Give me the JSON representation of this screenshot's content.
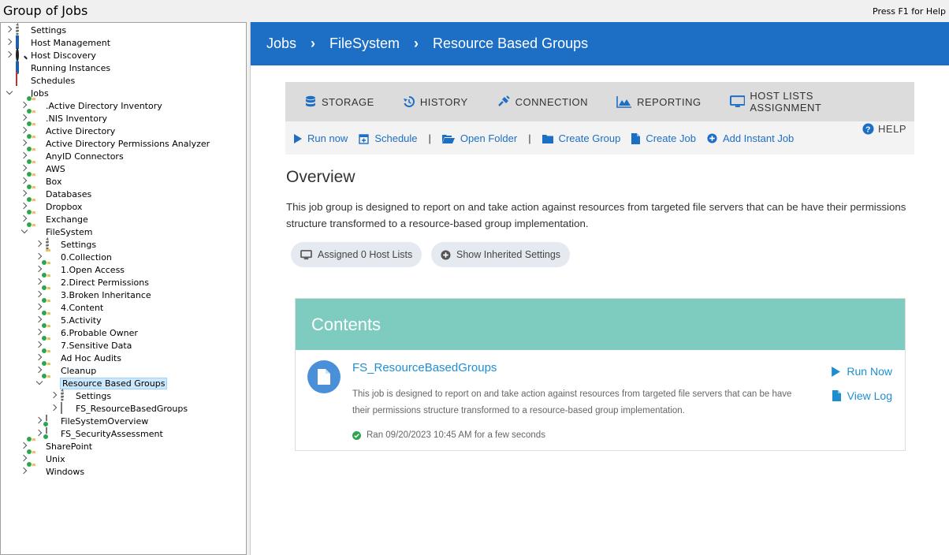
{
  "window": {
    "title": "Group of Jobs",
    "help_hint": "Press F1 for Help"
  },
  "tree": [
    {
      "label": "Settings",
      "level": 0,
      "toggle": "c",
      "icon": "gears-icon"
    },
    {
      "label": "Host Management",
      "level": 0,
      "toggle": "c",
      "icon": "monitor-icon"
    },
    {
      "label": "Host Discovery",
      "level": 0,
      "toggle": "c",
      "icon": "magnifier-icon"
    },
    {
      "label": "Running Instances",
      "level": 0,
      "toggle": "",
      "icon": "running-instances-icon"
    },
    {
      "label": "Schedules",
      "level": 0,
      "toggle": "",
      "icon": "calendar-icon"
    },
    {
      "label": "Jobs",
      "level": 0,
      "toggle": "e",
      "icon": "open-folder-icon"
    },
    {
      "label": ".Active Directory Inventory",
      "level": 1,
      "toggle": "c",
      "icon": "job-group-folder-icon"
    },
    {
      "label": ".NIS Inventory",
      "level": 1,
      "toggle": "c",
      "icon": "job-group-folder-icon"
    },
    {
      "label": "Active Directory",
      "level": 1,
      "toggle": "c",
      "icon": "job-group-folder-icon"
    },
    {
      "label": "Active Directory Permissions Analyzer",
      "level": 1,
      "toggle": "c",
      "icon": "job-group-folder-icon"
    },
    {
      "label": "AnyID Connectors",
      "level": 1,
      "toggle": "c",
      "icon": "job-group-folder-icon"
    },
    {
      "label": "AWS",
      "level": 1,
      "toggle": "c",
      "icon": "job-group-folder-icon"
    },
    {
      "label": "Box",
      "level": 1,
      "toggle": "c",
      "icon": "job-group-folder-icon"
    },
    {
      "label": "Databases",
      "level": 1,
      "toggle": "c",
      "icon": "job-group-folder-icon"
    },
    {
      "label": "Dropbox",
      "level": 1,
      "toggle": "c",
      "icon": "job-group-folder-icon"
    },
    {
      "label": "Exchange",
      "level": 1,
      "toggle": "c",
      "icon": "job-group-folder-icon"
    },
    {
      "label": "FileSystem",
      "level": 1,
      "toggle": "e",
      "icon": "job-group-folder-icon"
    },
    {
      "label": "Settings",
      "level": 2,
      "toggle": "c",
      "icon": "gears-icon"
    },
    {
      "label": "0.Collection",
      "level": 2,
      "toggle": "c",
      "icon": "folder-icon"
    },
    {
      "label": "1.Open Access",
      "level": 2,
      "toggle": "c",
      "icon": "job-group-folder-icon"
    },
    {
      "label": "2.Direct Permissions",
      "level": 2,
      "toggle": "c",
      "icon": "job-group-folder-icon"
    },
    {
      "label": "3.Broken Inheritance",
      "level": 2,
      "toggle": "c",
      "icon": "job-group-folder-icon"
    },
    {
      "label": "4.Content",
      "level": 2,
      "toggle": "c",
      "icon": "job-group-folder-icon"
    },
    {
      "label": "5.Activity",
      "level": 2,
      "toggle": "c",
      "icon": "job-group-folder-icon"
    },
    {
      "label": "6.Probable Owner",
      "level": 2,
      "toggle": "c",
      "icon": "job-group-folder-icon"
    },
    {
      "label": "7.Sensitive Data",
      "level": 2,
      "toggle": "c",
      "icon": "job-group-folder-icon"
    },
    {
      "label": "Ad Hoc Audits",
      "level": 2,
      "toggle": "c",
      "icon": "job-group-folder-icon"
    },
    {
      "label": "Cleanup",
      "level": 2,
      "toggle": "c",
      "icon": "job-group-folder-icon"
    },
    {
      "label": "Resource Based Groups",
      "level": 2,
      "toggle": "e",
      "icon": "job-group-folder-icon",
      "selected": true
    },
    {
      "label": "Settings",
      "level": 3,
      "toggle": "c",
      "icon": "gears-icon"
    },
    {
      "label": "FS_ResourceBasedGroups",
      "level": 3,
      "toggle": "c",
      "icon": "job-document-icon"
    },
    {
      "label": "FileSystemOverview",
      "level": 2,
      "toggle": "c",
      "icon": "job-document-checked-icon"
    },
    {
      "label": "FS_SecurityAssessment",
      "level": 2,
      "toggle": "c",
      "icon": "job-document-checked-icon"
    },
    {
      "label": "SharePoint",
      "level": 1,
      "toggle": "c",
      "icon": "job-group-folder-icon"
    },
    {
      "label": "Unix",
      "level": 1,
      "toggle": "c",
      "icon": "job-group-folder-icon"
    },
    {
      "label": "Windows",
      "level": 1,
      "toggle": "c",
      "icon": "job-group-folder-icon"
    }
  ],
  "breadcrumb": [
    "Jobs",
    "FileSystem",
    "Resource Based Groups"
  ],
  "tabs": [
    "STORAGE",
    "HISTORY",
    "CONNECTION",
    "REPORTING",
    "HOST LISTS ASSIGNMENT"
  ],
  "actions": {
    "run_now": "Run now",
    "schedule": "Schedule",
    "open_folder": "Open Folder",
    "create_group": "Create Group",
    "create_job": "Create Job",
    "add_instant_job": "Add Instant Job",
    "help": "HELP",
    "separator": "|"
  },
  "overview": {
    "title": "Overview",
    "description": "This job group is designed to report on and take action against resources from targeted file servers that can be have their permissions structure transformed to a resource-based group implementation.",
    "assigned_hosts": "Assigned 0 Host Lists",
    "show_inherited": "Show Inherited Settings"
  },
  "contents": {
    "title": "Contents",
    "job": {
      "name": "FS_ResourceBasedGroups",
      "description": "This job is designed to report on and take action against resources from targeted file servers that can be have their permissions structure transformed to a resource-based group implementation.",
      "last_run": "Ran 09/20/2023 10:45 AM for a few seconds",
      "run_now": "Run Now",
      "view_log": "View Log"
    }
  },
  "colors": {
    "accent": "#1d6ec5",
    "link": "#1d8fd1",
    "contents_header": "#7ecbbf",
    "success": "#2ea44f"
  }
}
